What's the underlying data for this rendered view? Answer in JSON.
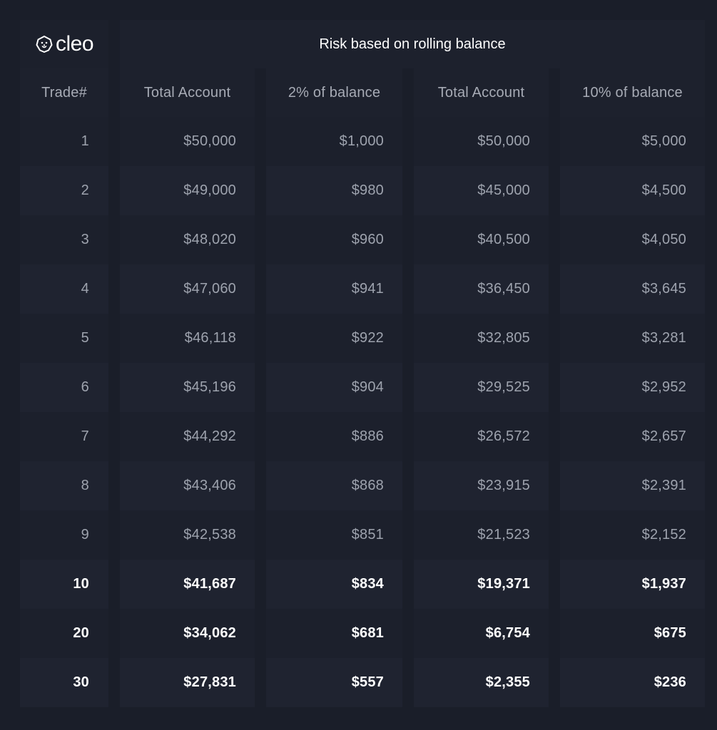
{
  "brand": {
    "logo_text": "cleo",
    "icon": "lion-head-icon"
  },
  "chart_data": {
    "type": "table",
    "title": "Risk based on rolling balance",
    "columns": [
      "Trade#",
      "Total Account",
      "2% of balance",
      "Total Account",
      "10% of balance"
    ],
    "rows": [
      [
        "1",
        "$50,000",
        "$1,000",
        "$50,000",
        "$5,000"
      ],
      [
        "2",
        "$49,000",
        "$980",
        "$45,000",
        "$4,500"
      ],
      [
        "3",
        "$48,020",
        "$960",
        "$40,500",
        "$4,050"
      ],
      [
        "4",
        "$47,060",
        "$941",
        "$36,450",
        "$3,645"
      ],
      [
        "5",
        "$46,118",
        "$922",
        "$32,805",
        "$3,281"
      ],
      [
        "6",
        "$45,196",
        "$904",
        "$29,525",
        "$2,952"
      ],
      [
        "7",
        "$44,292",
        "$886",
        "$26,572",
        "$2,657"
      ],
      [
        "8",
        "$43,406",
        "$868",
        "$23,915",
        "$2,391"
      ],
      [
        "9",
        "$42,538",
        "$851",
        "$21,523",
        "$2,152"
      ],
      [
        "10",
        "$41,687",
        "$834",
        "$19,371",
        "$1,937"
      ],
      [
        "20",
        "$34,062",
        "$681",
        "$6,754",
        "$675"
      ],
      [
        "30",
        "$27,831",
        "$557",
        "$2,355",
        "$236"
      ]
    ],
    "highlighted_rows": [
      "10",
      "20",
      "30"
    ]
  },
  "colors": {
    "background": "#1a1e29",
    "cell": "#1c202c",
    "text_muted": "#9ea3ae",
    "text_bold": "#ffffff"
  }
}
